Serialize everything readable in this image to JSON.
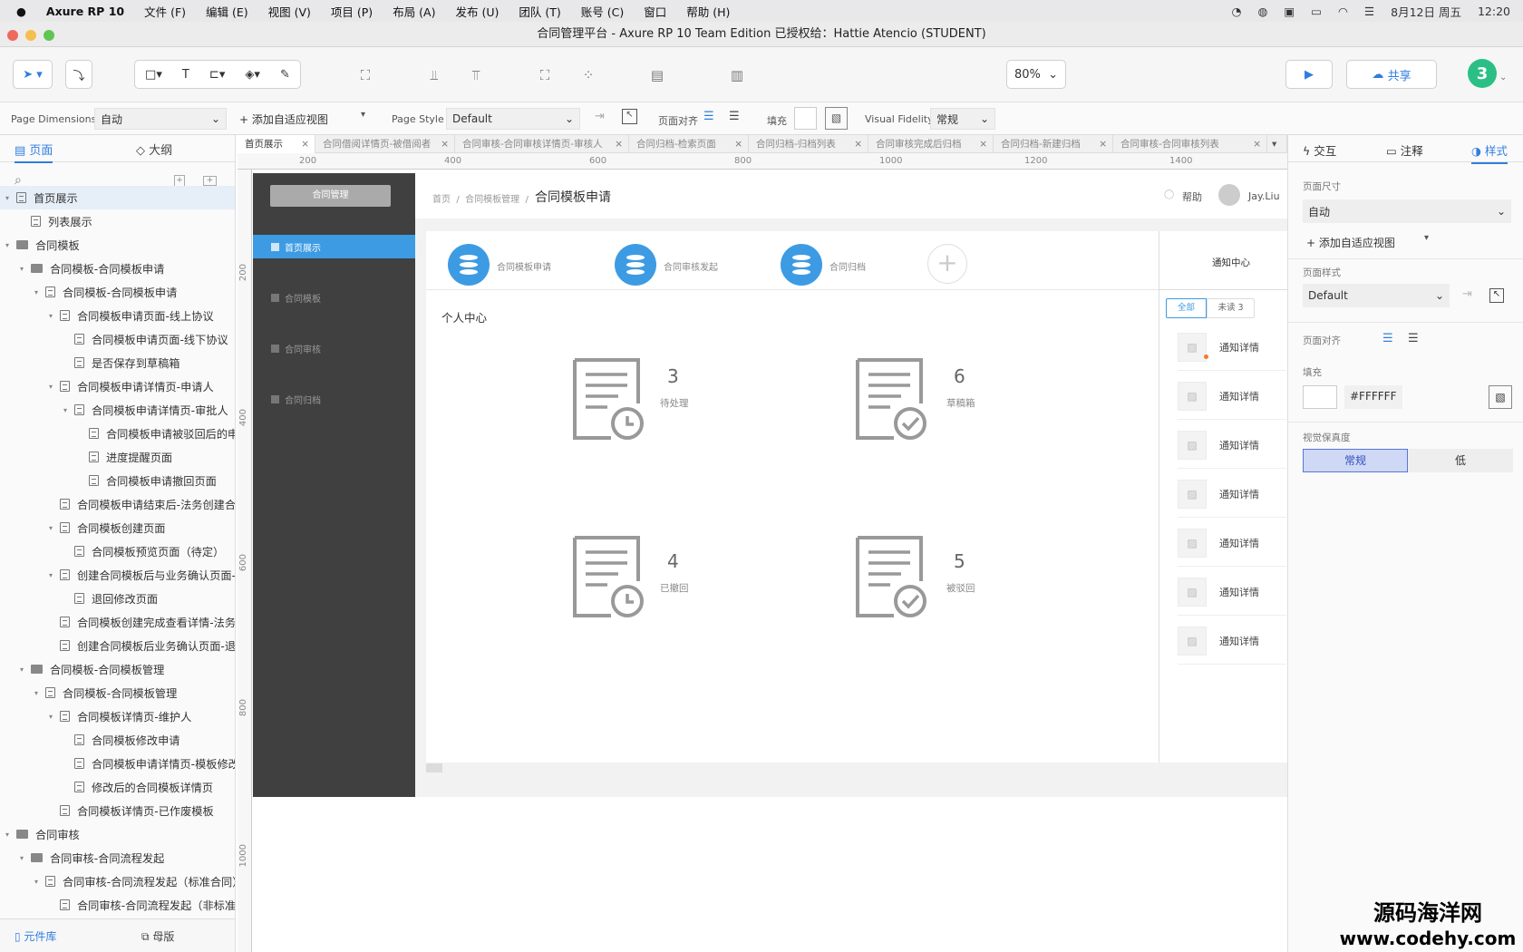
{
  "menubar": {
    "items": [
      "Axure RP 10",
      "文件 (F)",
      "编辑 (E)",
      "视图 (V)",
      "项目 (P)",
      "布局 (A)",
      "发布 (U)",
      "团队 (T)",
      "账号 (C)",
      "窗口",
      "帮助 (H)"
    ],
    "date": "8月12日 周五",
    "time": "12:20"
  },
  "window": {
    "title": "合同管理平台 - Axure RP 10 Team Edition  已授权给：Hattie Atencio (STUDENT)"
  },
  "toolbar": {
    "zoom": "80%",
    "share": "共享",
    "user_badge": "3"
  },
  "propbar": {
    "page_dimensions_label": "Page Dimensions",
    "page_dimensions_value": "自动",
    "add_adaptive": "+ 添加自适应视图",
    "page_style_label": "Page Style",
    "page_style_value": "Default",
    "page_align_label": "页面对齐",
    "fill_label": "填充",
    "visual_fidelity_label": "Visual Fidelity",
    "visual_fidelity_value": "常规"
  },
  "left": {
    "tab_pages": "页面",
    "tab_outline": "大纲",
    "bottom_library": "元件库",
    "bottom_masters": "母版",
    "tree": [
      {
        "label": "首页展示",
        "level": 0,
        "type": "page",
        "caret": "▾",
        "selected": true
      },
      {
        "label": "列表展示",
        "level": 1,
        "type": "page"
      },
      {
        "label": "合同模板",
        "level": 0,
        "type": "folder",
        "caret": "▾"
      },
      {
        "label": "合同模板-合同模板申请",
        "level": 1,
        "type": "folder",
        "caret": "▾"
      },
      {
        "label": "合同模板-合同模板申请",
        "level": 2,
        "type": "page",
        "caret": "▾"
      },
      {
        "label": "合同模板申请页面-线上协议",
        "level": 3,
        "type": "page",
        "caret": "▾"
      },
      {
        "label": "合同模板申请页面-线下协议",
        "level": 4,
        "type": "page"
      },
      {
        "label": "是否保存到草稿箱",
        "level": 4,
        "type": "page"
      },
      {
        "label": "合同模板申请详情页-申请人",
        "level": 3,
        "type": "page",
        "caret": "▾"
      },
      {
        "label": "合同模板申请详情页-审批人",
        "level": 4,
        "type": "page",
        "caret": "▾"
      },
      {
        "label": "合同模板申请被驳回后的申",
        "level": 5,
        "type": "page"
      },
      {
        "label": "进度提醒页面",
        "level": 5,
        "type": "page"
      },
      {
        "label": "合同模板申请撤回页面",
        "level": 5,
        "type": "page"
      },
      {
        "label": "合同模板申请结束后-法务创建合同",
        "level": 3,
        "type": "page"
      },
      {
        "label": "合同模板创建页面",
        "level": 3,
        "type": "page",
        "caret": "▾"
      },
      {
        "label": "合同模板预览页面（待定）",
        "level": 4,
        "type": "page"
      },
      {
        "label": "创建合同模板后与业务确认页面-法",
        "level": 3,
        "type": "page",
        "caret": "▾"
      },
      {
        "label": "退回修改页面",
        "level": 4,
        "type": "page"
      },
      {
        "label": "合同模板创建完成查看详情-法务人",
        "level": 3,
        "type": "page"
      },
      {
        "label": "创建合同模板后业务确认页面-退回",
        "level": 3,
        "type": "page"
      },
      {
        "label": "合同模板-合同模板管理",
        "level": 1,
        "type": "folder",
        "caret": "▾"
      },
      {
        "label": "合同模板-合同模板管理",
        "level": 2,
        "type": "page",
        "caret": "▾"
      },
      {
        "label": "合同模板详情页-维护人",
        "level": 3,
        "type": "page",
        "caret": "▾"
      },
      {
        "label": "合同模板修改申请",
        "level": 4,
        "type": "page"
      },
      {
        "label": "合同模板申请详情页-模板修改",
        "level": 4,
        "type": "page"
      },
      {
        "label": "修改后的合同模板详情页",
        "level": 4,
        "type": "page"
      },
      {
        "label": "合同模板详情页-已作废模板",
        "level": 3,
        "type": "page"
      },
      {
        "label": "合同审核",
        "level": 0,
        "type": "folder",
        "caret": "▾"
      },
      {
        "label": "合同审核-合同流程发起",
        "level": 1,
        "type": "folder",
        "caret": "▾"
      },
      {
        "label": "合同审核-合同流程发起（标准合同）",
        "level": 2,
        "type": "page",
        "caret": "▾"
      },
      {
        "label": "合同审核-合同流程发起（非标准合同）",
        "level": 3,
        "type": "page"
      }
    ]
  },
  "tabs": [
    "首页展示",
    "合同借阅详情页-被借阅者",
    "合同审核-合同审核详情页-审核人",
    "合同归档-检索页面",
    "合同归档-归档列表",
    "合同审核完成后归档",
    "合同归档-新建归档",
    "合同审核-合同审核列表"
  ],
  "ruler": {
    "h": [
      "200",
      "400",
      "600",
      "800",
      "1000",
      "1200",
      "1400"
    ],
    "v": [
      "200",
      "400",
      "600",
      "800",
      "1000"
    ]
  },
  "proto": {
    "sidebar_title": "合同管理",
    "nav": [
      "首页展示",
      "合同模板",
      "合同审核",
      "合同归档"
    ],
    "breadcrumb": [
      "首页",
      "合同模板管理"
    ],
    "page_title": "合同模板申请",
    "help": "帮助",
    "user": "Jay.Liu",
    "quick": [
      "合同模板申请",
      "合同审核发起",
      "合同归档"
    ],
    "personal_center": "个人中心",
    "stats": [
      {
        "num": "3",
        "label": "待处理"
      },
      {
        "num": "6",
        "label": "草稿箱"
      },
      {
        "num": "4",
        "label": "已撤回"
      },
      {
        "num": "5",
        "label": "被驳回"
      }
    ],
    "notice_title": "通知中心",
    "notice_tabs": [
      "全部",
      "未读 3"
    ],
    "notices": [
      "通知详情",
      "通知详情",
      "通知详情",
      "通知详情",
      "通知详情",
      "通知详情",
      "通知详情"
    ]
  },
  "right": {
    "tabs": [
      "交互",
      "注释",
      "样式"
    ],
    "page_size_label": "页面尺寸",
    "page_size_value": "自动",
    "add_adaptive": "+ 添加自适应视图",
    "page_style_label": "页面样式",
    "page_style_value": "Default",
    "page_align_label": "页面对齐",
    "fill_label": "填充",
    "fill_value": "#FFFFFF",
    "fidelity_label": "视觉保真度",
    "fidelity_options": [
      "常规",
      "低"
    ]
  },
  "watermark": {
    "line1": "源码海洋网",
    "line2": "www.codehy.com"
  },
  "colors": {
    "accent": "#3d9be3",
    "sidebar_bg": "#404040",
    "active_nav": "#3d9be3"
  }
}
